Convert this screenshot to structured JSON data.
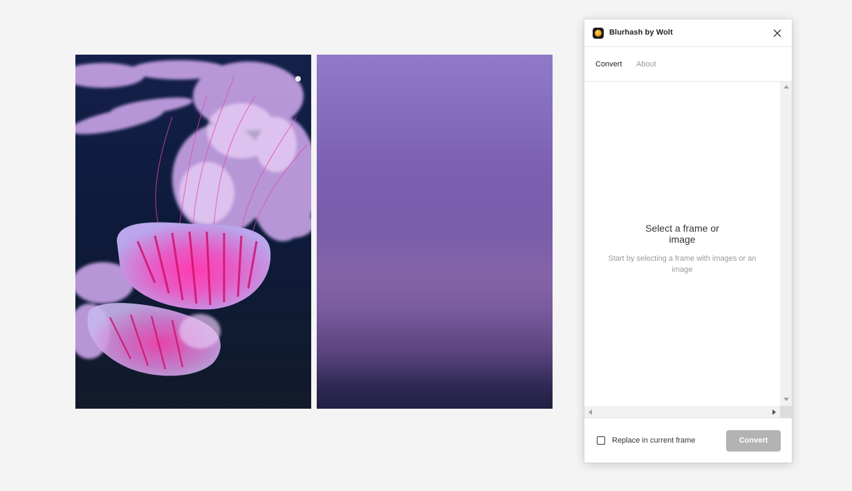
{
  "canvas": {
    "original_image": {
      "name": "jellyfish-photo"
    },
    "blurred_image": {
      "name": "blurhash-preview"
    }
  },
  "plugin": {
    "title": "Blurhash by Wolt",
    "icon": "blurhash-app-icon",
    "close_icon": "close-icon",
    "tabs": [
      {
        "label": "Convert",
        "active": true
      },
      {
        "label": "About",
        "active": false
      }
    ],
    "empty_state": {
      "title": "Select a frame or image",
      "subtitle": "Start by selecting a frame with images or an image"
    },
    "footer": {
      "checkbox_label": "Replace in current frame",
      "checkbox_checked": false,
      "convert_label": "Convert",
      "convert_enabled": false
    }
  },
  "colors": {
    "canvas_bg": "#f4f4f4",
    "button_disabled": "#b3b3b3",
    "text_primary": "#222222",
    "text_muted": "#9a9a9a"
  }
}
